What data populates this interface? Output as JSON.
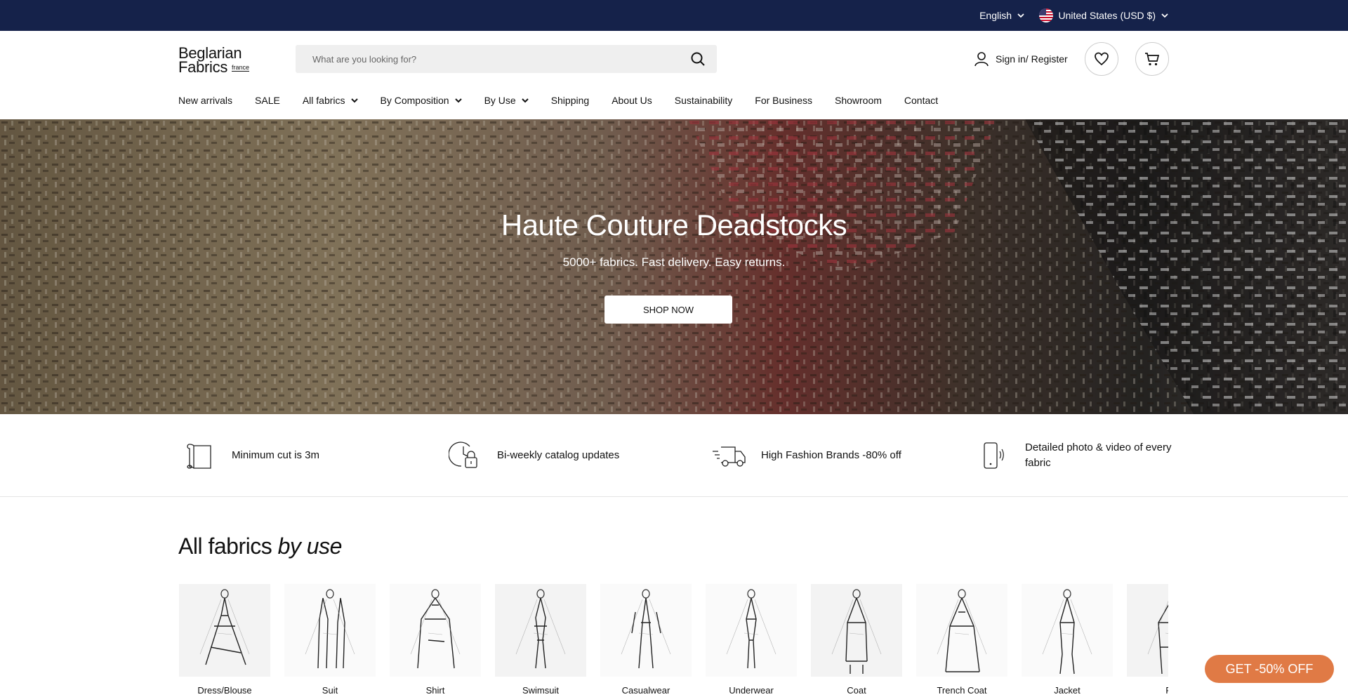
{
  "topbar": {
    "language": "English",
    "country": "United States (USD $)"
  },
  "header": {
    "logo_line1": "Beglarian",
    "logo_line2": "Fabrics",
    "logo_tag": "france",
    "search_placeholder": "What are you looking for?",
    "signin_label": "Sign in/ Register"
  },
  "nav": {
    "items": [
      {
        "label": "New arrivals",
        "dropdown": false
      },
      {
        "label": "SALE",
        "dropdown": false
      },
      {
        "label": "All fabrics",
        "dropdown": true
      },
      {
        "label": "By Composition",
        "dropdown": true
      },
      {
        "label": "By Use",
        "dropdown": true
      },
      {
        "label": "Shipping",
        "dropdown": false
      },
      {
        "label": "About Us",
        "dropdown": false
      },
      {
        "label": "Sustainability",
        "dropdown": false
      },
      {
        "label": "For Business",
        "dropdown": false
      },
      {
        "label": "Showroom",
        "dropdown": false
      },
      {
        "label": "Contact",
        "dropdown": false
      }
    ]
  },
  "hero": {
    "title": "Haute Couture Deadstocks",
    "subtitle": "5000+ fabrics. Fast delivery. Easy returns.",
    "button": "SHOP NOW"
  },
  "features": [
    {
      "icon": "fabric-roll-icon",
      "text": "Minimum cut is 3m"
    },
    {
      "icon": "clock-lock-icon",
      "text": "Bi-weekly catalog updates"
    },
    {
      "icon": "delivery-truck-icon",
      "text": "High Fashion Brands -80% off"
    },
    {
      "icon": "phone-icon",
      "text": "Detailed photo & video of every fabric"
    }
  ],
  "by_use": {
    "title_main": "All fabrics",
    "title_em": "by use",
    "categories": [
      "Dress/Blouse",
      "Suit",
      "Shirt",
      "Swimsuit",
      "Casualwear",
      "Underwear",
      "Coat",
      "Trench Coat",
      "Jacket",
      "Fur"
    ]
  },
  "promo": {
    "label": "GET -50% OFF"
  },
  "colors": {
    "topbar": "#15224a",
    "promo": "#e07a45"
  }
}
